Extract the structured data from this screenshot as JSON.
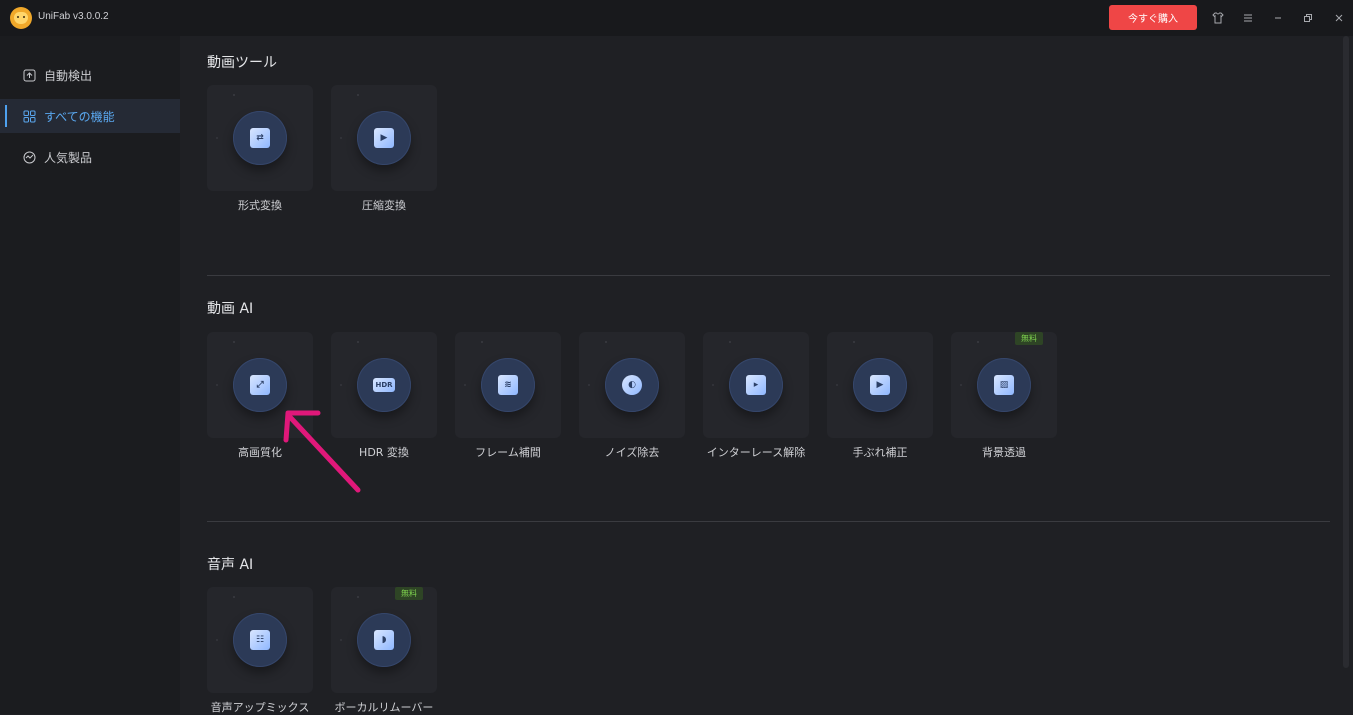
{
  "titlebar": {
    "app_title": "UniFab v3.0.0.2",
    "buy_label": "今すぐ購入",
    "buy_color": "#ef4646",
    "icons": [
      "shirt-icon",
      "menu-icon",
      "minimize-icon",
      "restore-icon",
      "close-icon"
    ]
  },
  "sidebar": {
    "items": [
      {
        "label": "自動検出",
        "icon": "auto-detect-icon",
        "active": false
      },
      {
        "label": "すべての機能",
        "icon": "grid-icon",
        "active": true
      },
      {
        "label": "人気製品",
        "icon": "popular-icon",
        "active": false
      }
    ],
    "accent_color": "#4ea1ef"
  },
  "sections": {
    "video_tools": {
      "title": "動画ツール",
      "cards": [
        {
          "label": "形式変換",
          "icon": "convert-icon"
        },
        {
          "label": "圧縮変換",
          "icon": "compress-icon"
        }
      ]
    },
    "video_ai": {
      "title": "動画 AI",
      "cards": [
        {
          "label": "高画質化",
          "icon": "upscale-icon"
        },
        {
          "label": "HDR 変換",
          "icon": "hdr-icon",
          "glyph": "HDR"
        },
        {
          "label": "フレーム補間",
          "icon": "frame-interpolation-icon"
        },
        {
          "label": "ノイズ除去",
          "icon": "denoise-icon"
        },
        {
          "label": "インターレース解除",
          "icon": "deinterlace-icon"
        },
        {
          "label": "手ぶれ補正",
          "icon": "stabilize-icon"
        },
        {
          "label": "背景透過",
          "icon": "background-remove-icon",
          "badge": "無料"
        }
      ]
    },
    "audio_ai": {
      "title": "音声 AI",
      "cards": [
        {
          "label": "音声アップミックス",
          "icon": "audio-upmix-icon"
        },
        {
          "label": "ボーカルリムーバー",
          "icon": "vocal-remover-icon",
          "badge": "無料"
        }
      ]
    }
  },
  "annotation": {
    "arrow_color": "#e0187a"
  }
}
